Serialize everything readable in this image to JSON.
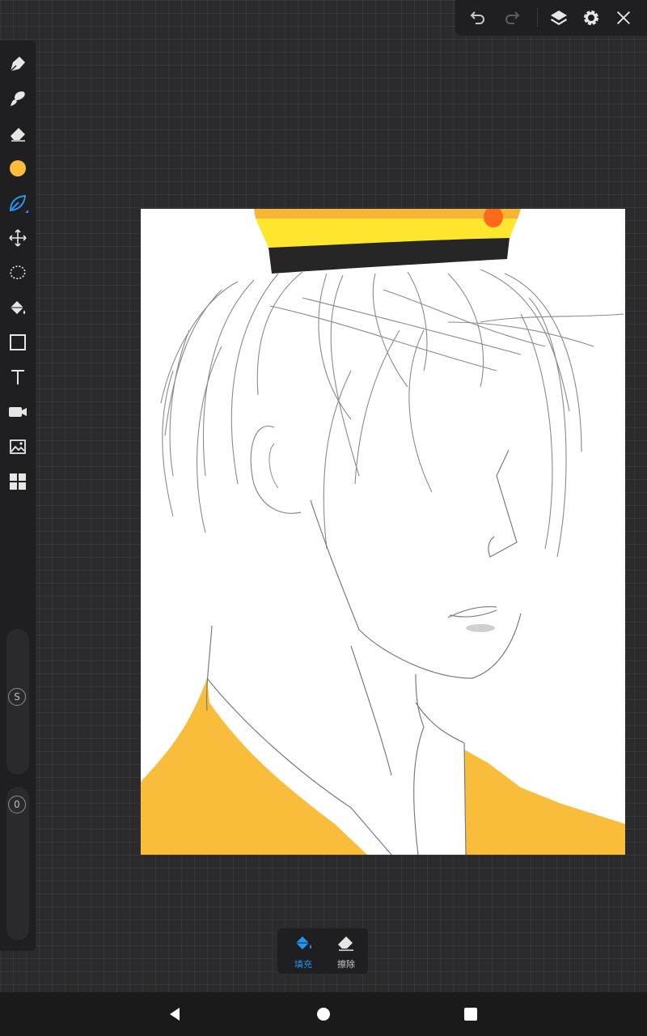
{
  "top_toolbar": {
    "icons": [
      "undo-icon",
      "redo-icon",
      "layers-icon",
      "settings-icon",
      "close-icon"
    ]
  },
  "left_toolbar": {
    "tools": [
      "pen-icon",
      "brush-icon",
      "eraser-icon",
      "color-swatch",
      "smudge-leaf-icon",
      "move-transform-icon",
      "lasso-icon",
      "fill-bucket-icon",
      "shape-rectangle-icon",
      "text-icon",
      "video-icon",
      "image-import-icon",
      "grid-apps-icon"
    ],
    "active_color": "#f9bd3b",
    "selected_tool_color": "#2196f3",
    "size_slider": {
      "knob_label": "S"
    },
    "opacity_slider": {
      "knob_label": "0"
    }
  },
  "fill_popup": {
    "fill_label": "填充",
    "erase_label": "擦除",
    "active_color": "#2196f3"
  },
  "canvas": {
    "background": "#ffffff",
    "palette": {
      "jacket": "#f9bd3b",
      "hat_yellow": "#ffe62e",
      "hat_band": "#262626",
      "jewel": "#ff6a1a",
      "line": "#8a8a8a"
    }
  },
  "nav_bar": {
    "icons": [
      "back-icon",
      "home-icon",
      "recents-icon"
    ]
  }
}
